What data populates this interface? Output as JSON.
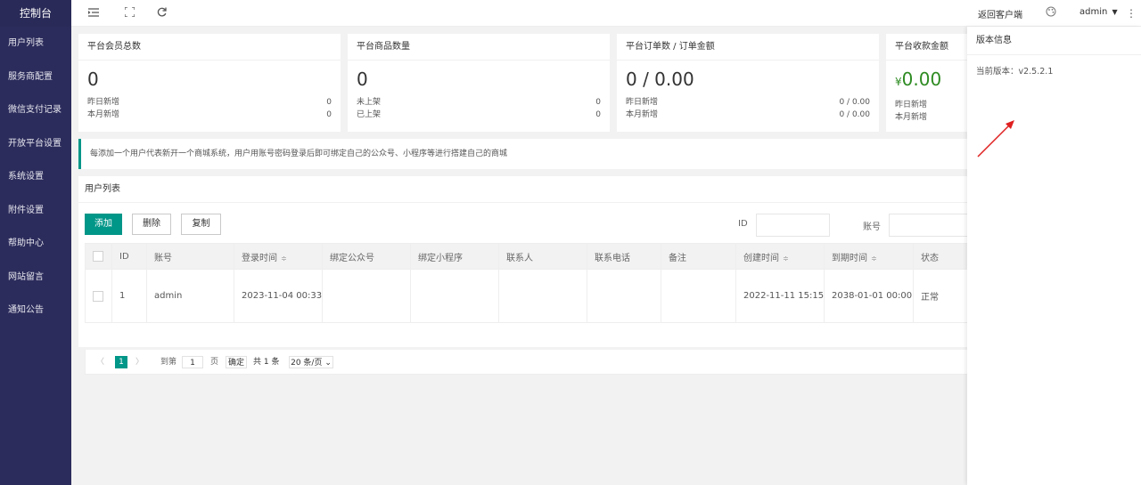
{
  "sidebar": {
    "logo": "控制台",
    "items": [
      {
        "label": "用户列表"
      },
      {
        "label": "服务商配置"
      },
      {
        "label": "微信支付记录"
      },
      {
        "label": "开放平台设置"
      },
      {
        "label": "系统设置"
      },
      {
        "label": "附件设置"
      },
      {
        "label": "帮助中心"
      },
      {
        "label": "网站留言"
      },
      {
        "label": "通知公告"
      }
    ]
  },
  "header": {
    "icons": [
      "menu-fold-icon",
      "fullscreen-icon",
      "refresh-icon"
    ],
    "back_link": "返回客户端",
    "theme_icon": "palette-icon",
    "user": "admin",
    "more_icon": "more-vertical-icon"
  },
  "stats": [
    {
      "title": "平台会员总数",
      "value": "0",
      "rows": [
        {
          "label": "昨日新增",
          "value": "0"
        },
        {
          "label": "本月新增",
          "value": "0"
        }
      ]
    },
    {
      "title": "平台商品数量",
      "value": "0",
      "rows": [
        {
          "label": "未上架",
          "value": "0"
        },
        {
          "label": "已上架",
          "value": "0"
        }
      ]
    },
    {
      "title": "平台订单数 / 订单金额",
      "value": "0 / 0.00",
      "rows": [
        {
          "label": "昨日新增",
          "value": "0 / 0.00"
        },
        {
          "label": "本月新增",
          "value": "0 / 0.00"
        }
      ]
    },
    {
      "title": "平台收款金额",
      "currency": "¥",
      "value": "0.00",
      "rows": [
        {
          "label": "昨日新增",
          "value": ""
        },
        {
          "label": "本月新增",
          "value": ""
        }
      ]
    }
  ],
  "notice": "每添加一个用户代表新开一个商城系统，用户用账号密码登录后即可绑定自己的公众号、小程序等进行搭建自己的商城",
  "panel": {
    "title": "用户列表",
    "buttons": {
      "add": "添加",
      "delete": "删除",
      "copy": "复制"
    },
    "filters": {
      "id_label": "ID",
      "account_label": "账号"
    }
  },
  "table": {
    "columns": [
      "ID",
      "账号",
      "登录时间",
      "绑定公众号",
      "绑定小程序",
      "联系人",
      "联系电话",
      "备注",
      "创建时间",
      "到期时间",
      "状态"
    ],
    "sort_glyph": "≑",
    "rows": [
      {
        "id": "1",
        "account": "admin",
        "login_time": "2023-11-04 00:33",
        "mp": "",
        "miniapp": "",
        "contact": "",
        "phone": "",
        "remark": "",
        "created": "2022-11-11 15:15",
        "expires": "2038-01-01 00:00",
        "status": "正常"
      }
    ]
  },
  "pager": {
    "prev": "〈",
    "current": "1",
    "next": "〉",
    "goto_label": "到第",
    "goto_value": "1",
    "page_label": "页",
    "confirm": "确定",
    "total": "共 1 条",
    "page_size": "20 条/页"
  },
  "right_panel": {
    "title": "版本信息",
    "version": "当前版本：v2.5.2.1"
  },
  "colors": {
    "sidebar": "#2c2c5c",
    "accent": "#009688",
    "arrow": "#e02020",
    "status_ok": "#2e8b22"
  }
}
